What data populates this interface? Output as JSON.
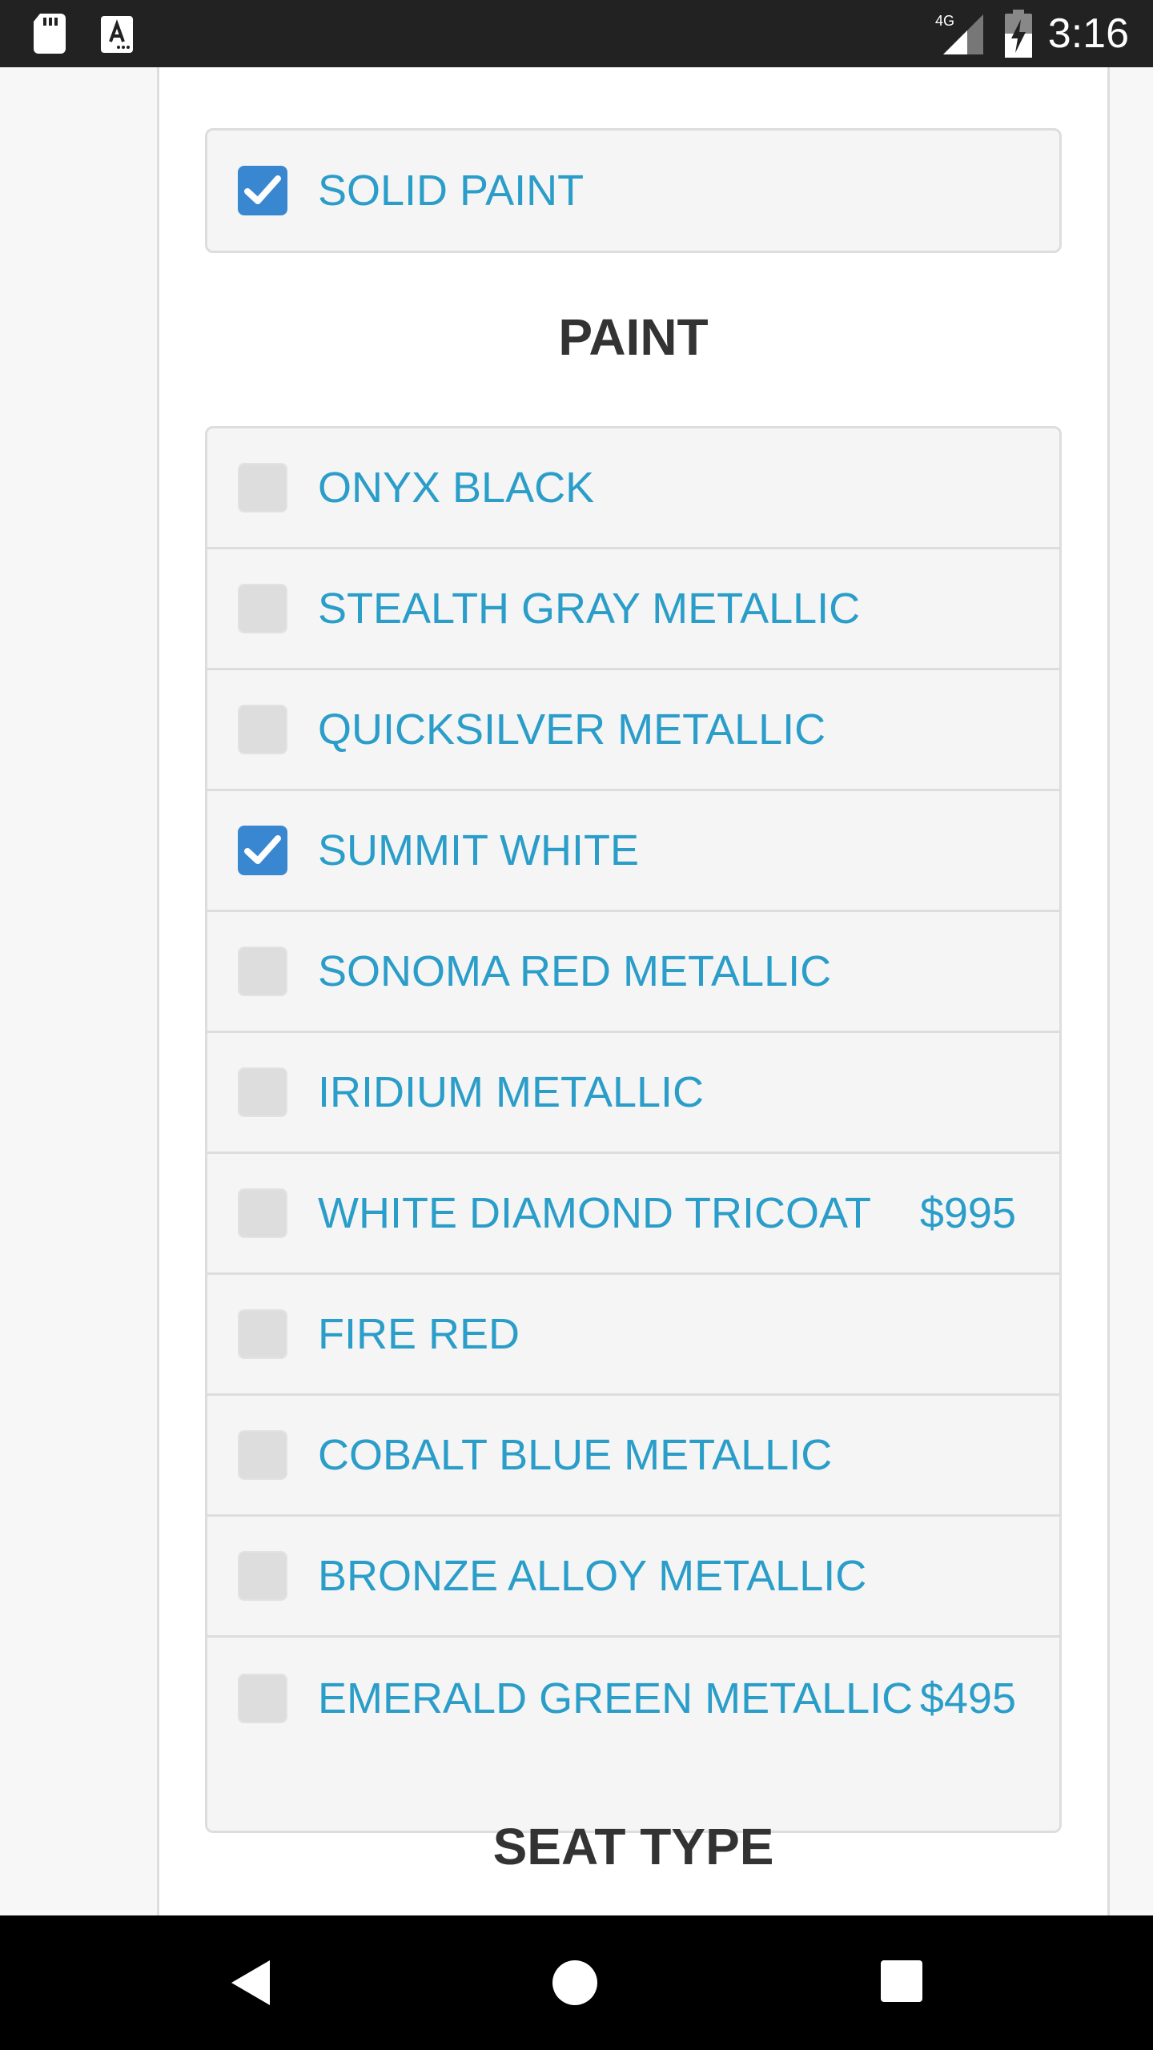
{
  "status_bar": {
    "time": "3:16",
    "network": "4G",
    "icons": [
      "sd-card-icon",
      "text-a-icon",
      "signal-icon",
      "battery-charging-icon"
    ]
  },
  "solid_paint": {
    "label": "SOLID PAINT",
    "checked": true
  },
  "paint_section": {
    "title": "PAINT",
    "options": [
      {
        "label": "ONYX BLACK",
        "price": "",
        "checked": false
      },
      {
        "label": "STEALTH GRAY METALLIC",
        "price": "",
        "checked": false
      },
      {
        "label": "QUICKSILVER METALLIC",
        "price": "",
        "checked": false
      },
      {
        "label": "SUMMIT WHITE",
        "price": "",
        "checked": true
      },
      {
        "label": "SONOMA RED METALLIC",
        "price": "",
        "checked": false
      },
      {
        "label": "IRIDIUM METALLIC",
        "price": "",
        "checked": false
      },
      {
        "label": "WHITE DIAMOND TRICOAT",
        "price": "$995",
        "checked": false
      },
      {
        "label": "FIRE RED",
        "price": "",
        "checked": false
      },
      {
        "label": "COBALT BLUE METALLIC",
        "price": "",
        "checked": false
      },
      {
        "label": "BRONZE ALLOY METALLIC",
        "price": "",
        "checked": false
      },
      {
        "label": "EMERALD GREEN METALLIC",
        "price": "$495",
        "checked": false
      }
    ]
  },
  "seat_section": {
    "title": "SEAT TYPE"
  },
  "nav_bar": {
    "buttons": [
      "back-icon",
      "home-icon",
      "recent-apps-icon"
    ]
  },
  "colors": {
    "accent_text": "#2a9dc9",
    "checkbox_checked": "#3a87d1",
    "checkbox_unchecked": "#dddddd",
    "heading": "#333333"
  }
}
